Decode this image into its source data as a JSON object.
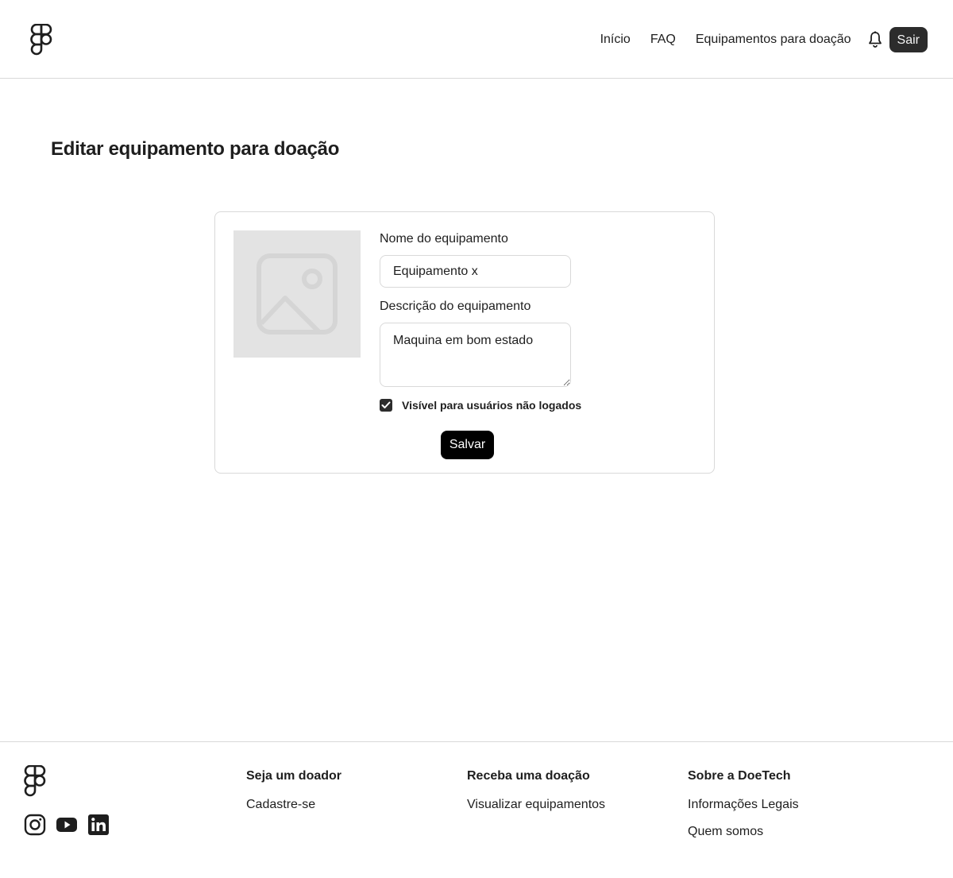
{
  "header": {
    "nav": [
      {
        "label": "Início"
      },
      {
        "label": "FAQ"
      },
      {
        "label": "Equipamentos para doação"
      }
    ],
    "logout_label": "Sair"
  },
  "page": {
    "title": "Editar equipamento para doação"
  },
  "form": {
    "name_label": "Nome do equipamento",
    "name_value": "Equipamento x",
    "description_label": "Descrição do equipamento",
    "description_value": "Maquina em bom estado",
    "visibility_label": "Visível para usuários não logados",
    "visibility_checked": true,
    "save_label": "Salvar"
  },
  "footer": {
    "socials": [
      "instagram-icon",
      "youtube-icon",
      "linkedin-icon"
    ],
    "columns": [
      {
        "title": "Seja um doador",
        "links": [
          "Cadastre-se"
        ]
      },
      {
        "title": "Receba uma doação",
        "links": [
          "Visualizar equipamentos"
        ]
      },
      {
        "title": "Sobre a DoeTech",
        "links": [
          "Informações Legais",
          "Quem somos"
        ]
      }
    ]
  },
  "colors": {
    "primary_button": "#2c2c2c",
    "border": "#d9d9d9",
    "placeholder_bg": "#e3e3e3"
  }
}
